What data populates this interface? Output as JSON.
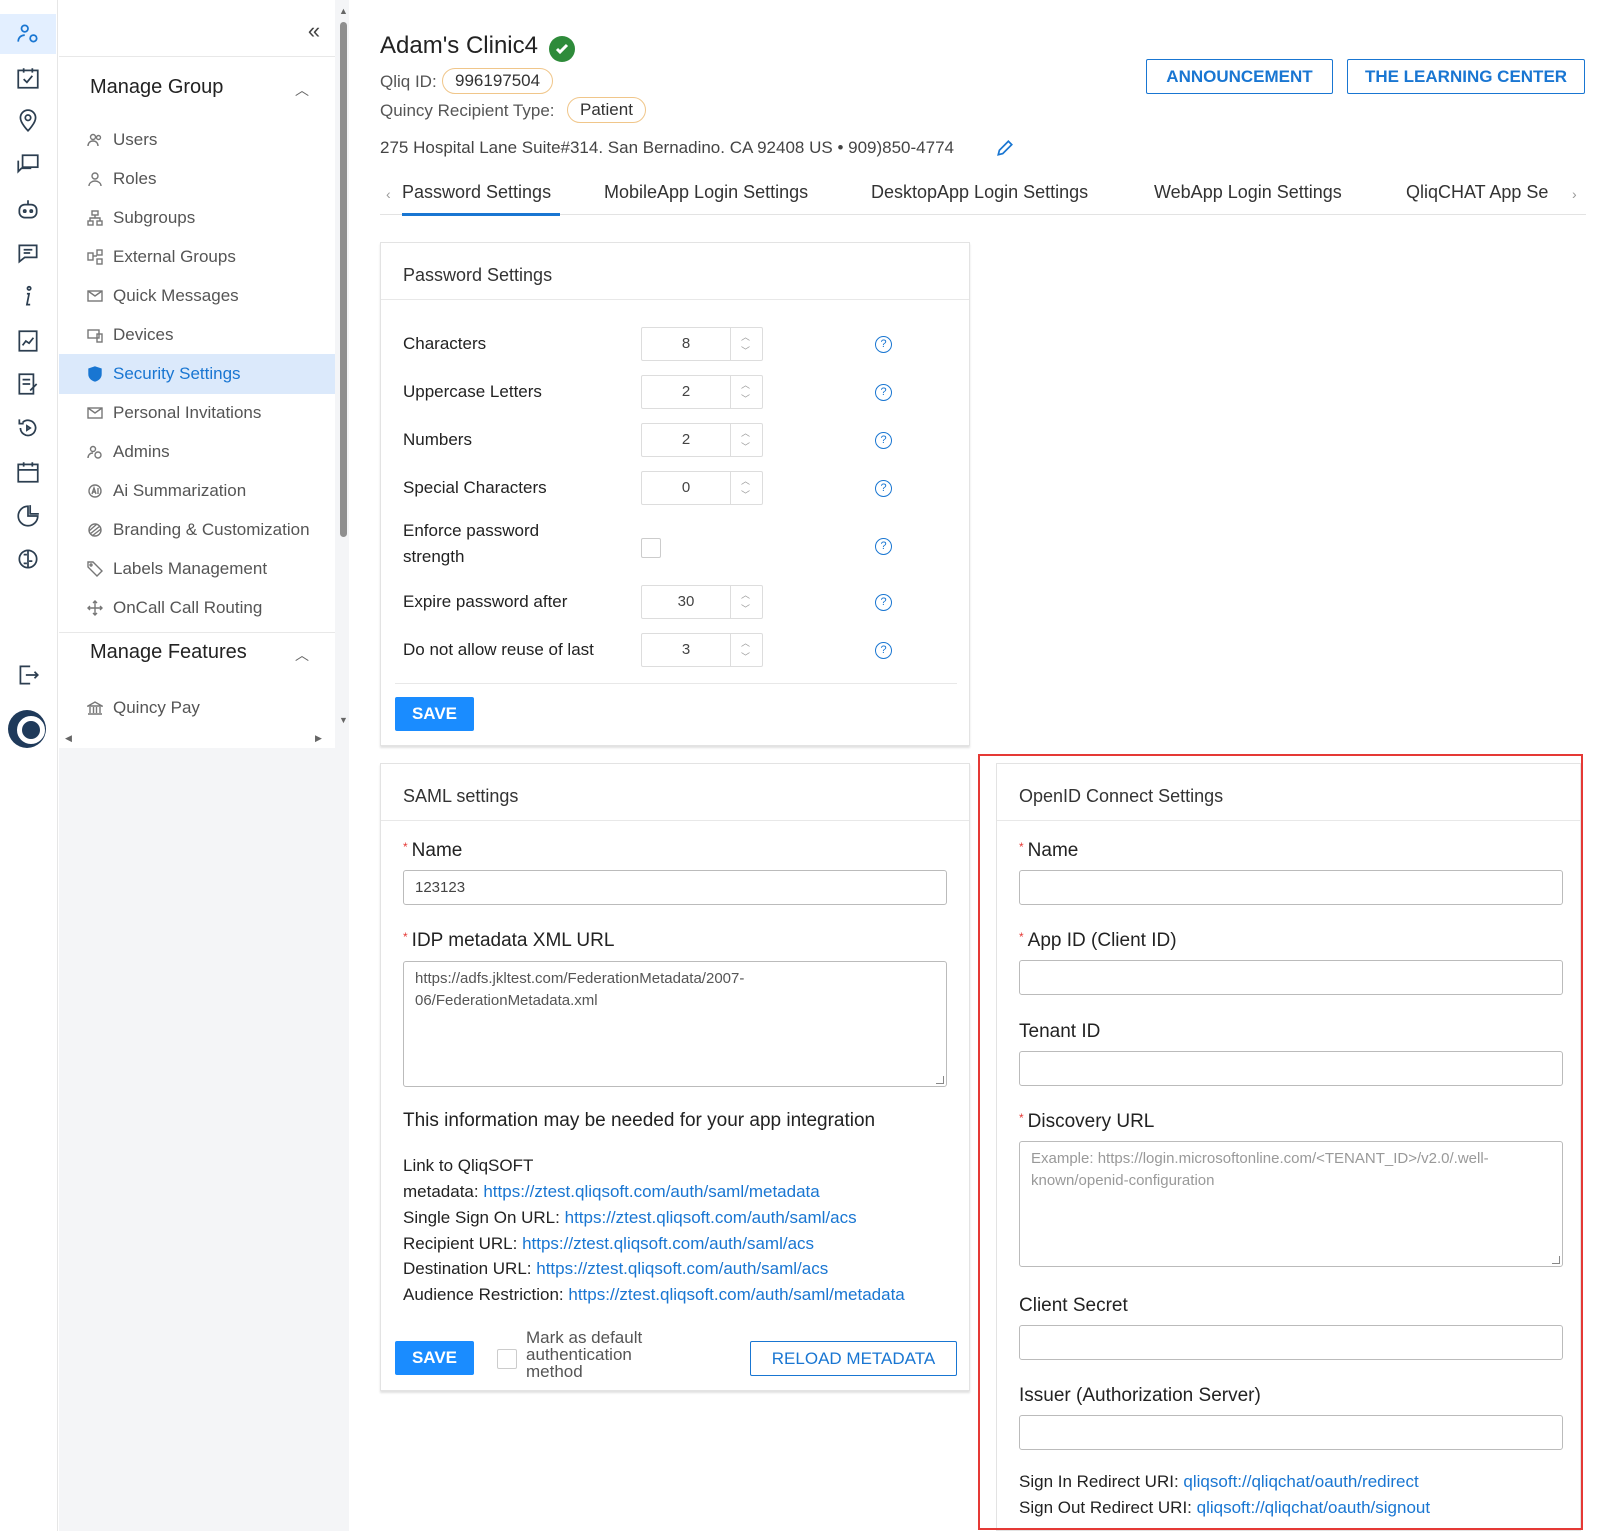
{
  "sidebar": {
    "collapse_icon": "double-chevron-left",
    "group1": "Manage Group",
    "items": [
      {
        "label": "Users",
        "icon": "users-icon"
      },
      {
        "label": "Roles",
        "icon": "roles-icon"
      },
      {
        "label": "Subgroups",
        "icon": "subgroups-icon"
      },
      {
        "label": "External Groups",
        "icon": "external-groups-icon"
      },
      {
        "label": "Quick Messages",
        "icon": "quick-messages-icon"
      },
      {
        "label": "Devices",
        "icon": "devices-icon"
      },
      {
        "label": "Security Settings",
        "icon": "shield-icon",
        "active": true
      },
      {
        "label": "Personal Invitations",
        "icon": "envelope-icon"
      },
      {
        "label": "Admins",
        "icon": "admins-icon"
      },
      {
        "label": "Ai Summarization",
        "icon": "ai-icon"
      },
      {
        "label": "Branding & Customization",
        "icon": "branding-icon"
      },
      {
        "label": "Labels Management",
        "icon": "tag-icon"
      },
      {
        "label": "OnCall Call Routing",
        "icon": "routing-icon"
      }
    ],
    "group2": "Manage Features",
    "items2": [
      {
        "label": "Quincy Pay",
        "icon": "bank-icon"
      }
    ]
  },
  "header": {
    "title": "Adam's Clinic4",
    "qliq_id_label": "Qliq ID:",
    "qliq_id": "996197504",
    "recipient_type_label": "Quincy Recipient Type:",
    "recipient_type": "Patient",
    "address": "275 Hospital Lane Suite#314. San Bernadino. CA 92408 US • 909)850-4774",
    "buttons": {
      "announcement": "ANNOUNCEMENT",
      "learning_center": "THE LEARNING CENTER"
    }
  },
  "tabs": [
    {
      "label": "Password Settings",
      "active": true
    },
    {
      "label": "MobileApp Login Settings"
    },
    {
      "label": "DesktopApp Login Settings"
    },
    {
      "label": "WebApp Login Settings"
    },
    {
      "label": "QliqCHAT App Se"
    }
  ],
  "password_settings": {
    "title": "Password Settings",
    "rows": [
      {
        "label": "Characters",
        "value": "8"
      },
      {
        "label": "Uppercase Letters",
        "value": "2"
      },
      {
        "label": "Numbers",
        "value": "2"
      },
      {
        "label": "Special Characters",
        "value": "0"
      },
      {
        "label_line1": "Enforce password",
        "label_line2": "strength",
        "checked": false
      },
      {
        "label": "Expire password after",
        "value": "30"
      },
      {
        "label": "Do not allow reuse of last",
        "value": "3"
      }
    ],
    "save": "SAVE"
  },
  "saml": {
    "title": "SAML settings",
    "name_label": "Name",
    "name_value": "123123",
    "idp_label": "IDP metadata XML URL",
    "idp_value_line1": "https://adfs.jkltest.com/FederationMetadata/2007-",
    "idp_value_line2": "06/FederationMetadata.xml",
    "info_heading": "This information may be needed for your app integration",
    "link_label_line1": "Link to QliqSOFT",
    "metadata_label": "metadata:",
    "metadata_url": "https://ztest.qliqsoft.com/auth/saml/metadata",
    "sso_label": "Single Sign On URL:",
    "sso_url": "https://ztest.qliqsoft.com/auth/saml/acs",
    "recipient_label": "Recipient URL:",
    "recipient_url": "https://ztest.qliqsoft.com/auth/saml/acs",
    "destination_label": "Destination URL:",
    "destination_url": "https://ztest.qliqsoft.com/auth/saml/acs",
    "audience_label": "Audience Restriction:",
    "audience_url": "https://ztest.qliqsoft.com/auth/saml/metadata",
    "save": "SAVE",
    "default_line1": "Mark as default",
    "default_line2": "authentication",
    "default_line3": "method",
    "reload": "RELOAD METADATA"
  },
  "openid": {
    "title": "OpenID Connect Settings",
    "name_label": "Name",
    "app_id_label": "App ID (Client ID)",
    "tenant_label": "Tenant ID",
    "discovery_label": "Discovery URL",
    "discovery_placeholder_line1": "Example: https://login.microsoftonline.com/<TENANT_ID>/v2.0/.well-",
    "discovery_placeholder_line2": "known/openid-configuration",
    "secret_label": "Client Secret",
    "issuer_label": "Issuer (Authorization Server)",
    "sign_in_label": "Sign In Redirect URI:",
    "sign_in_uri": "qliqsoft://qliqchat/oauth/redirect",
    "sign_out_label": "Sign Out Redirect URI:",
    "sign_out_uri": "qliqsoft://qliqchat/oauth/signout"
  },
  "colors": {
    "accent": "#1976d2",
    "primary_button": "#1a8cff",
    "highlight": "#e53935",
    "verified": "#2e8b3a"
  }
}
